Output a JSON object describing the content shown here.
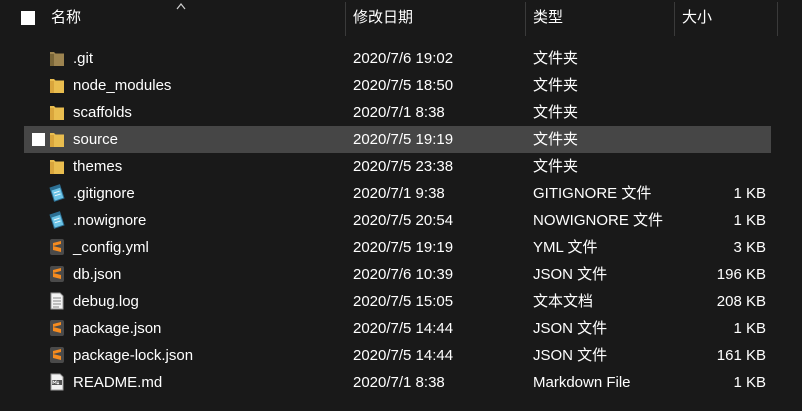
{
  "header": {
    "name": "名称",
    "date": "修改日期",
    "type": "类型",
    "size": "大小"
  },
  "files": [
    {
      "name": ".git",
      "date": "2020/7/6 19:02",
      "type": "文件夹",
      "size": "",
      "icon": "folder-dark-icon"
    },
    {
      "name": "node_modules",
      "date": "2020/7/5 18:50",
      "type": "文件夹",
      "size": "",
      "icon": "folder-icon"
    },
    {
      "name": "scaffolds",
      "date": "2020/7/1 8:38",
      "type": "文件夹",
      "size": "",
      "icon": "folder-icon"
    },
    {
      "name": "source",
      "date": "2020/7/5 19:19",
      "type": "文件夹",
      "size": "",
      "icon": "folder-icon"
    },
    {
      "name": "themes",
      "date": "2020/7/5 23:38",
      "type": "文件夹",
      "size": "",
      "icon": "folder-icon"
    },
    {
      "name": ".gitignore",
      "date": "2020/7/1 9:38",
      "type": "GITIGNORE 文件",
      "size": "1 KB",
      "icon": "notepad-icon"
    },
    {
      "name": ".nowignore",
      "date": "2020/7/5 20:54",
      "type": "NOWIGNORE 文件",
      "size": "1 KB",
      "icon": "notepad-icon"
    },
    {
      "name": "_config.yml",
      "date": "2020/7/5 19:19",
      "type": "YML 文件",
      "size": "3 KB",
      "icon": "sublime-icon"
    },
    {
      "name": "db.json",
      "date": "2020/7/6 10:39",
      "type": "JSON 文件",
      "size": "196 KB",
      "icon": "sublime-icon"
    },
    {
      "name": "debug.log",
      "date": "2020/7/5 15:05",
      "type": "文本文档",
      "size": "208 KB",
      "icon": "text-document-icon"
    },
    {
      "name": "package.json",
      "date": "2020/7/5 14:44",
      "type": "JSON 文件",
      "size": "1 KB",
      "icon": "sublime-icon"
    },
    {
      "name": "package-lock.json",
      "date": "2020/7/5 14:44",
      "type": "JSON 文件",
      "size": "161 KB",
      "icon": "sublime-icon"
    },
    {
      "name": "README.md",
      "date": "2020/7/1 8:38",
      "type": "Markdown File",
      "size": "1 KB",
      "icon": "markdown-icon"
    }
  ],
  "selected_index": 3,
  "colors": {
    "background": "#191919",
    "selected_row": "#464646",
    "folder": "#e9bd4f",
    "folder_dark": "#8a7345",
    "sublime": "#f58b1f"
  }
}
